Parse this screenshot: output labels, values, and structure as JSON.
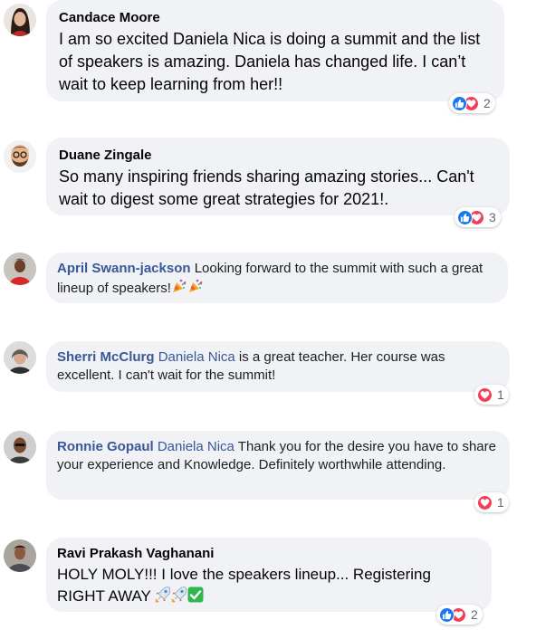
{
  "comments": [
    {
      "name": "Candace Moore",
      "text": "I am so excited Daniela Nica is doing a summit and the list of speakers is amazing. Daniela has changed life. I can’t wait to keep learning from her!!",
      "reactions": [
        "like",
        "love"
      ],
      "reaction_count": "2"
    },
    {
      "name": "Duane Zingale",
      "text": "So many inspiring friends sharing amazing stories... Can't wait to digest some great strategies for 2021!.",
      "reactions": [
        "like",
        "love"
      ],
      "reaction_count": "3"
    },
    {
      "name": "April Swann-jackson",
      "text": "Looking forward to the summit with such a great lineup of speakers!",
      "emojis": [
        "party-popper-icon",
        "party-popper-icon"
      ]
    },
    {
      "name": "Sherri McClurg",
      "mention": "Daniela Nica",
      "text": "is a great teacher. Her course was excellent. I can't wait for the summit!",
      "reactions": [
        "love"
      ],
      "reaction_count": "1"
    },
    {
      "name": "Ronnie Gopaul",
      "mention": "Daniela Nica",
      "text": "Thank you for the desire you have to share your experience and Knowledge. Definitely worthwhile attending.",
      "reactions": [
        "love"
      ],
      "reaction_count": "1"
    },
    {
      "name": "Ravi Prakash Vaghanani",
      "text": "HOLY MOLY!!! I love the speakers lineup... Registering RIGHT AWAY",
      "emojis": [
        "rocket-icon",
        "rocket-icon",
        "check-mark-button-icon"
      ],
      "reactions": [
        "like",
        "love"
      ],
      "reaction_count": "2"
    }
  ],
  "colors": {
    "bubble": "#f0f2f5",
    "name_link": "#385898",
    "like": "#1877f2",
    "love": "#f33e58",
    "count": "#65676b"
  }
}
